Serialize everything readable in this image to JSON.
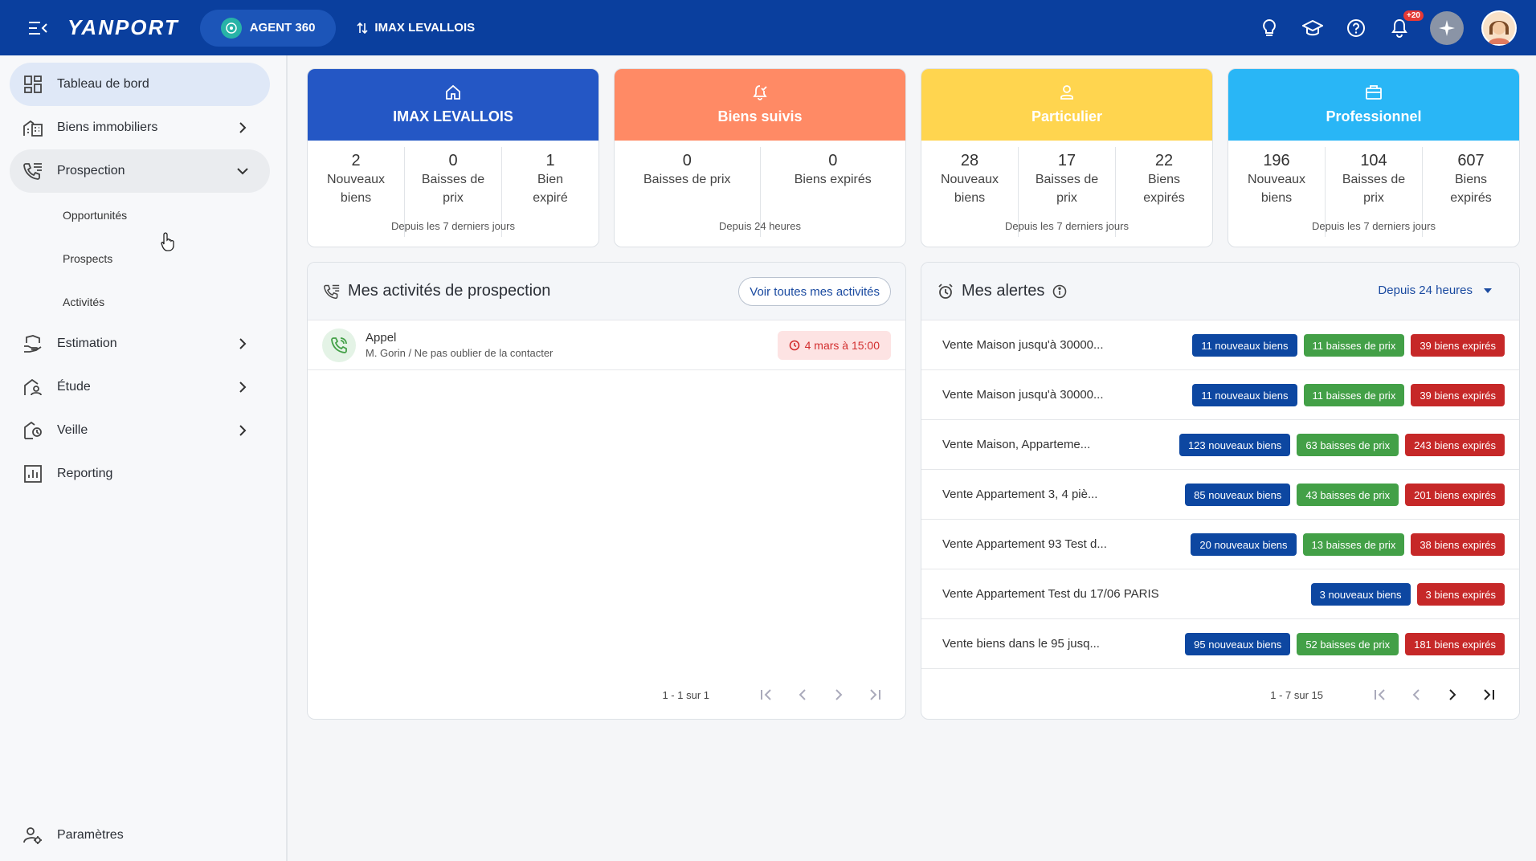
{
  "topbar": {
    "logo": "YANPORT",
    "agent_label": "AGENT 360",
    "agency_label": "IMAX LEVALLOIS",
    "notif_count": "+20",
    "color": "#0a3f9e"
  },
  "sidebar": {
    "items": [
      {
        "label": "Tableau de bord",
        "icon": "dashboard-icon"
      },
      {
        "label": "Biens immobiliers",
        "icon": "buildings-icon"
      },
      {
        "label": "Prospection",
        "icon": "phone-list-icon"
      },
      {
        "label": "Estimation",
        "icon": "house-hand-icon"
      },
      {
        "label": "Étude",
        "icon": "house-person-icon"
      },
      {
        "label": "Veille",
        "icon": "watch-icon"
      },
      {
        "label": "Reporting",
        "icon": "report-icon"
      }
    ],
    "sub_items": [
      "Opportunités",
      "Prospects",
      "Activités"
    ],
    "settings_label": "Paramètres"
  },
  "cards": [
    {
      "title": "IMAX LEVALLOIS",
      "color": "#2457c5",
      "stats": [
        {
          "value": "2",
          "label": "Nouveaux biens"
        },
        {
          "value": "0",
          "label": "Baisses de prix"
        },
        {
          "value": "1",
          "label": "Bien expiré"
        }
      ],
      "footer": "Depuis les 7 derniers jours"
    },
    {
      "title": "Biens suivis",
      "color": "#ff8a65",
      "stats": [
        {
          "value": "0",
          "label": "Baisses de prix"
        },
        {
          "value": "0",
          "label": "Biens expirés"
        }
      ],
      "footer": "Depuis 24 heures"
    },
    {
      "title": "Particulier",
      "color": "#ffd54f",
      "stats": [
        {
          "value": "28",
          "label": "Nouveaux biens"
        },
        {
          "value": "17",
          "label": "Baisses de prix"
        },
        {
          "value": "22",
          "label": "Biens expirés"
        }
      ],
      "footer": "Depuis les 7 derniers jours"
    },
    {
      "title": "Professionnel",
      "color": "#29b6f6",
      "stats": [
        {
          "value": "196",
          "label": "Nouveaux biens"
        },
        {
          "value": "104",
          "label": "Baisses de prix"
        },
        {
          "value": "607",
          "label": "Biens expirés"
        }
      ],
      "footer": "Depuis les 7 derniers jours"
    }
  ],
  "activities": {
    "title": "Mes activités de prospection",
    "see_all": "Voir toutes mes activités",
    "items": [
      {
        "title": "Appel",
        "subtitle": "M. Gorin / Ne pas oublier de la contacter",
        "date": "4 mars à 15:00"
      }
    ],
    "pager": "1 - 1 sur 1"
  },
  "alerts": {
    "title": "Mes alertes",
    "period": "Depuis 24 heures",
    "items": [
      {
        "name": "Vente Maison jusqu'à 30000...",
        "new": "11 nouveaux biens",
        "drops": "11 baisses de prix",
        "expired": "39 biens expirés"
      },
      {
        "name": "Vente Maison jusqu'à 30000...",
        "new": "11 nouveaux biens",
        "drops": "11 baisses de prix",
        "expired": "39 biens expirés"
      },
      {
        "name": "Vente Maison, Apparteme...",
        "new": "123 nouveaux biens",
        "drops": "63 baisses de prix",
        "expired": "243 biens expirés"
      },
      {
        "name": "Vente Appartement 3, 4 piè...",
        "new": "85 nouveaux biens",
        "drops": "43 baisses de prix",
        "expired": "201 biens expirés"
      },
      {
        "name": "Vente Appartement 93 Test d...",
        "new": "20 nouveaux biens",
        "drops": "13 baisses de prix",
        "expired": "38 biens expirés"
      },
      {
        "name": "Vente Appartement Test du 17/06 PARIS",
        "new": "3 nouveaux biens",
        "drops": "",
        "expired": "3 biens expirés"
      },
      {
        "name": "Vente biens dans le 95 jusq...",
        "new": "95 nouveaux biens",
        "drops": "52 baisses de prix",
        "expired": "181 biens expirés"
      }
    ],
    "pager": "1 - 7 sur 15",
    "colors": {
      "new": "#0d47a1",
      "drops": "#43a047",
      "expired": "#c62828"
    }
  }
}
